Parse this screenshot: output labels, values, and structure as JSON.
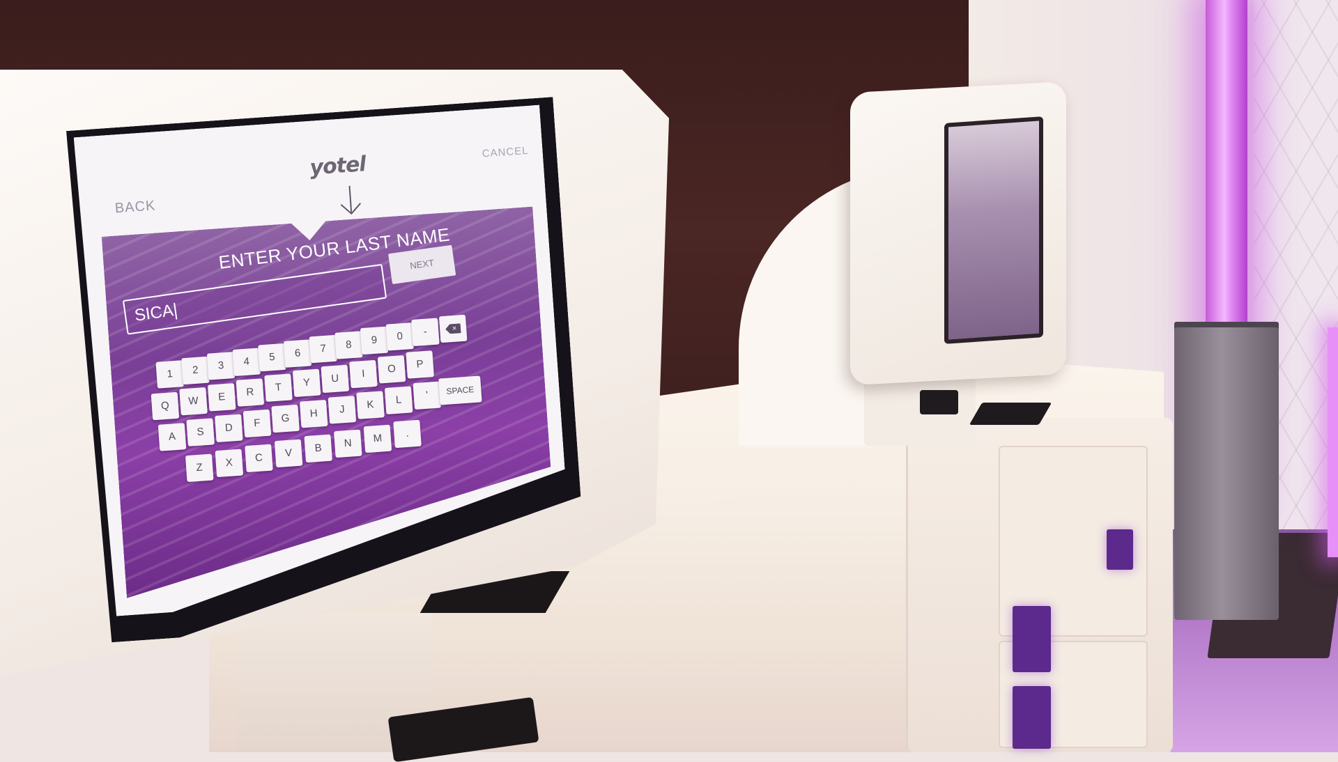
{
  "kiosk": {
    "logo": "yotel",
    "back_label": "BACK",
    "cancel_label": "CANCEL",
    "heading": "ENTER YOUR LAST NAME",
    "input_value": "SICA",
    "next_label": "NEXT",
    "keyboard": {
      "row1": [
        "1",
        "2",
        "3",
        "4",
        "5",
        "6",
        "7",
        "8",
        "9",
        "0",
        "-"
      ],
      "row2": [
        "Q",
        "W",
        "E",
        "R",
        "T",
        "Y",
        "U",
        "I",
        "O",
        "P"
      ],
      "row3": [
        "A",
        "S",
        "D",
        "F",
        "G",
        "H",
        "J",
        "K",
        "L",
        "'"
      ],
      "row4": [
        "Z",
        "X",
        "C",
        "V",
        "B",
        "N",
        "M",
        "."
      ],
      "space_label": "SPACE",
      "delete_icon": "backspace-icon"
    }
  },
  "colors": {
    "accent_purple": "#7a3f97",
    "neon": "#e48cf5",
    "wall": "#3a1d1c"
  }
}
